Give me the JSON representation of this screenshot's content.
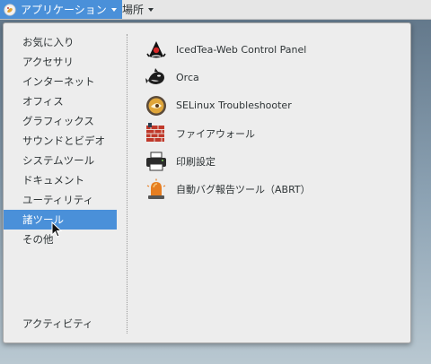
{
  "topbar": {
    "apps_label": "アプリケーション",
    "places_label": "場所"
  },
  "categories": [
    {
      "label": "お気に入り"
    },
    {
      "label": "アクセサリ"
    },
    {
      "label": "インターネット"
    },
    {
      "label": "オフィス"
    },
    {
      "label": "グラフィックス"
    },
    {
      "label": "サウンドとビデオ"
    },
    {
      "label": "システムツール"
    },
    {
      "label": "ドキュメント"
    },
    {
      "label": "ユーティリティ"
    },
    {
      "label": "諸ツール",
      "selected": true
    },
    {
      "label": "その他"
    }
  ],
  "activities_label": "アクティビティ",
  "apps": [
    {
      "label": "IcedTea-Web Control Panel",
      "icon": "java-duke-icon"
    },
    {
      "label": "Orca",
      "icon": "orca-whale-icon"
    },
    {
      "label": "SELinux Troubleshooter",
      "icon": "selinux-icon"
    },
    {
      "label": "ファイアウォール",
      "icon": "firewall-icon"
    },
    {
      "label": "印刷設定",
      "icon": "printer-icon"
    },
    {
      "label": "自動バグ報告ツール（ABRT）",
      "icon": "alarm-light-icon"
    }
  ],
  "colors": {
    "accent": "#4a90d9",
    "menu_bg": "#ededed",
    "text": "#2e3436"
  }
}
